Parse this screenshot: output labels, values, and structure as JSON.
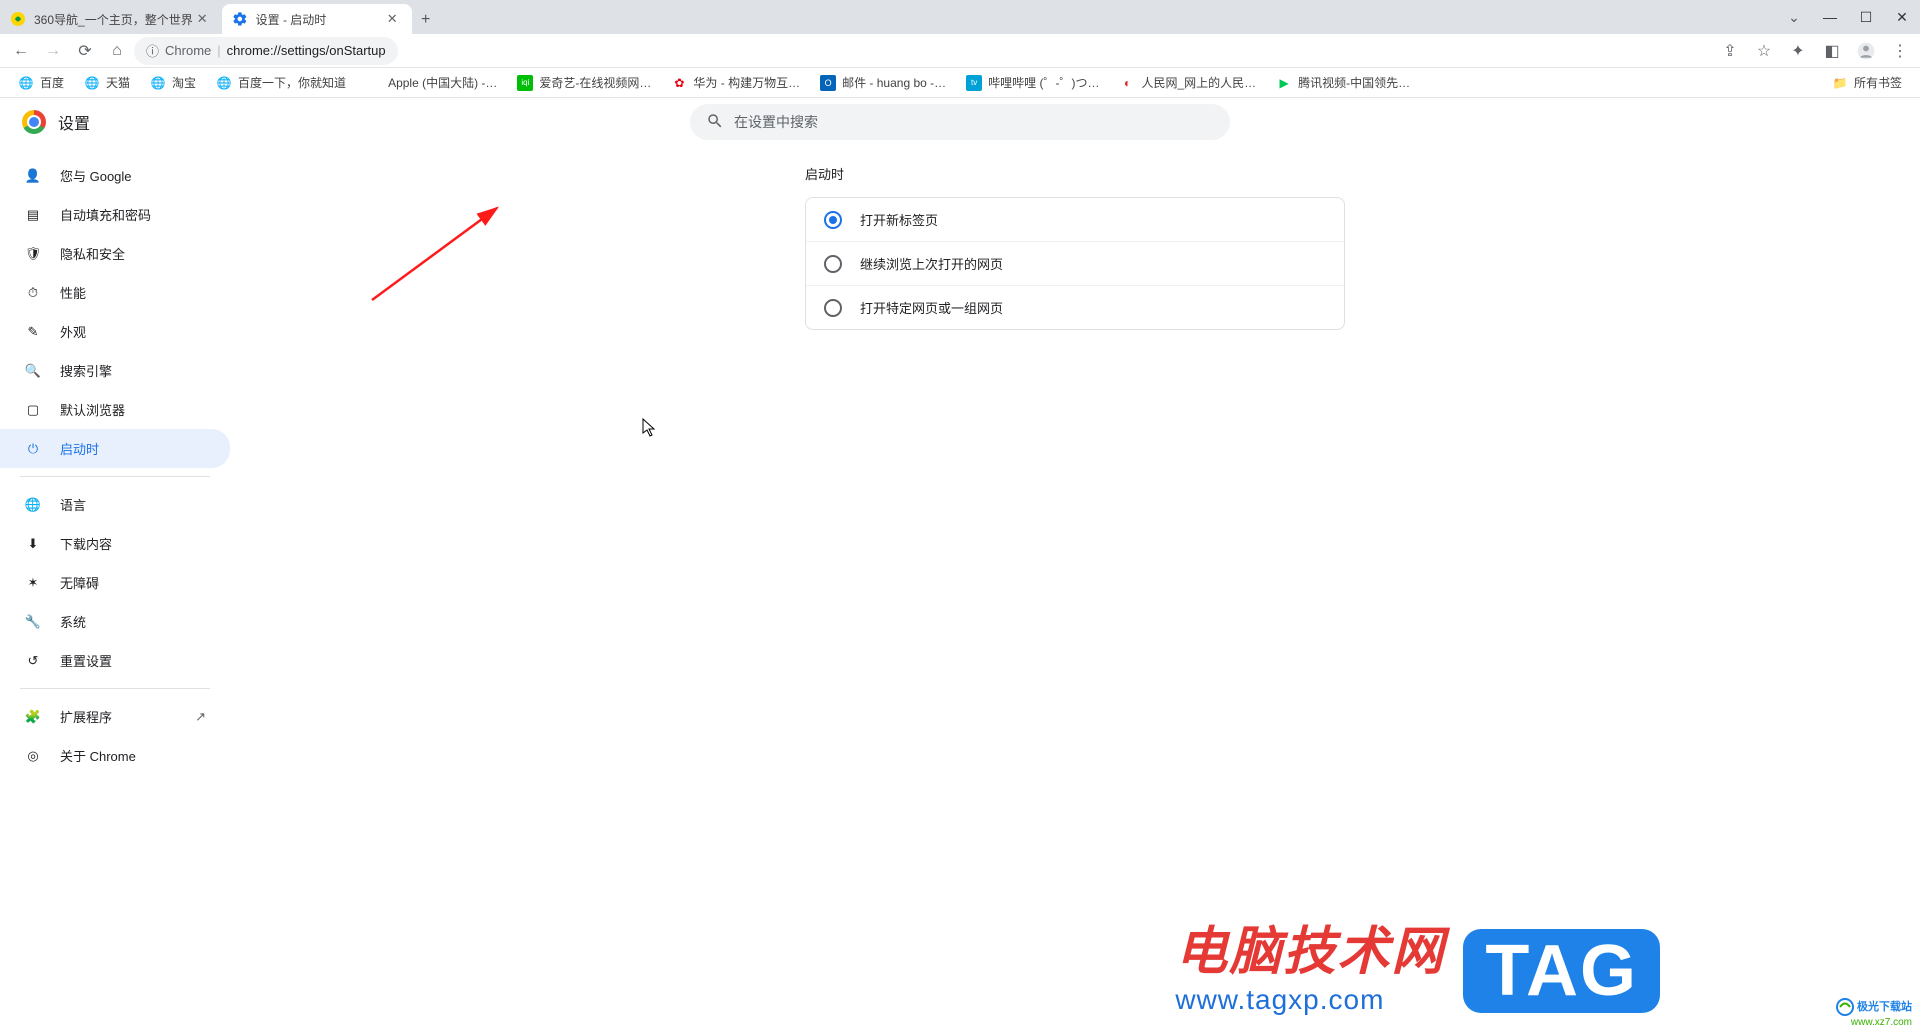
{
  "tabs": [
    {
      "title": "360导航_一个主页，整个世界"
    },
    {
      "title": "设置 - 启动时"
    }
  ],
  "window_controls": {
    "chevron": "⌄",
    "minimize": "—",
    "maximize": "☐",
    "close": "✕"
  },
  "toolbar": {
    "url_prefix": "Chrome",
    "url_path": "chrome://settings/onStartup",
    "new_tab_plus": "+"
  },
  "bookmarks": {
    "items": [
      {
        "label": "百度"
      },
      {
        "label": "天猫"
      },
      {
        "label": "淘宝"
      },
      {
        "label": "百度一下，你就知道"
      },
      {
        "label": "Apple (中国大陆) -…"
      },
      {
        "label": "爱奇艺-在线视频网…"
      },
      {
        "label": "华为 - 构建万物互…"
      },
      {
        "label": "邮件 - huang bo -…"
      },
      {
        "label": "哔哩哔哩 (゜-゜)つ…"
      },
      {
        "label": "人民网_网上的人民…"
      },
      {
        "label": "腾讯视频-中国领先…"
      }
    ],
    "all": "所有书签"
  },
  "settings": {
    "title": "设置",
    "search_placeholder": "在设置中搜索",
    "sidebar": {
      "items": [
        {
          "label": "您与 Google"
        },
        {
          "label": "自动填充和密码"
        },
        {
          "label": "隐私和安全"
        },
        {
          "label": "性能"
        },
        {
          "label": "外观"
        },
        {
          "label": "搜索引擎"
        },
        {
          "label": "默认浏览器"
        },
        {
          "label": "启动时"
        }
      ],
      "extra": [
        {
          "label": "语言"
        },
        {
          "label": "下载内容"
        },
        {
          "label": "无障碍"
        },
        {
          "label": "系统"
        },
        {
          "label": "重置设置"
        }
      ],
      "footer": [
        {
          "label": "扩展程序"
        },
        {
          "label": "关于 Chrome"
        }
      ]
    },
    "section_title": "启动时",
    "options": [
      {
        "label": "打开新标签页",
        "checked": true
      },
      {
        "label": "继续浏览上次打开的网页",
        "checked": false
      },
      {
        "label": "打开特定网页或一组网页",
        "checked": false
      }
    ]
  },
  "watermark": {
    "line1": "电脑技术网",
    "line2": "www.tagxp.com",
    "tag": "TAG"
  },
  "download_badge": {
    "l1": "极光下载站",
    "l2": "www.xz7.com"
  }
}
